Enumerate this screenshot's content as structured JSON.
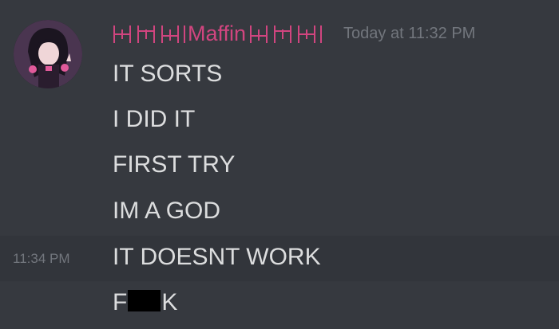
{
  "message": {
    "username": "Maffin",
    "timestamp": "Today at 11:32 PM",
    "lines": [
      "IT SORTS",
      "I DID IT",
      "FIRST TRY",
      "IM A GOD",
      "IT DOESNT WORK"
    ],
    "hover_timestamp": "11:34 PM",
    "censored_line": {
      "prefix": "F",
      "suffix": "K"
    }
  },
  "colors": {
    "background": "#36393f",
    "hover_row": "#32353b",
    "username": "#d1457f",
    "text": "#dcddde",
    "timestamp": "#72767d"
  }
}
